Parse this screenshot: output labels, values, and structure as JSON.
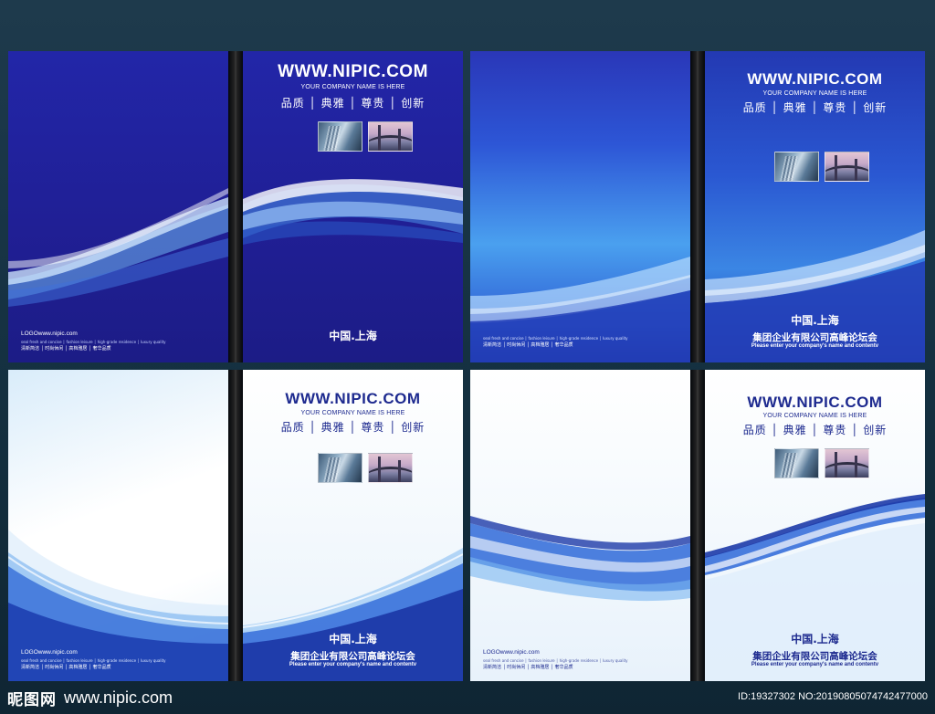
{
  "covers": [
    {
      "variant": "dark-wave",
      "url": "WWW.NIPIC.COM",
      "company_en": "YOUR COMPANY NAME IS HERE",
      "slogan": "品质 │ 典雅 │ 尊贵 │ 创新",
      "city": "中国.上海",
      "logo": "LOGOwww.nipic.com",
      "fine_print": "seal fresh and concise │ fashion leisure │ high-grade residence │ luxury quality",
      "features": "清新简洁 │ 时尚休闲 │ 高档雅居 │ 奢华品质"
    },
    {
      "variant": "sky-wave",
      "url": "WWW.NIPIC.COM",
      "company_en": "YOUR COMPANY NAME IS HERE",
      "slogan": "品质 │ 典雅 │ 尊贵 │ 创新",
      "city": "中国.上海",
      "company_cn": "集团企业有限公司高峰论坛会",
      "enter_text": "Please enter your company's name and contentv",
      "fine_print": "seal fresh and concise │ fashion leisure │ high-grade residence │ luxury quality",
      "features": "清新简洁 │ 时尚休闲 │ 高档雅居 │ 奢华品质"
    },
    {
      "variant": "white-sky",
      "url": "WWW.NIPIC.COM",
      "company_en": "YOUR COMPANY NAME IS HERE",
      "slogan": "品质 │ 典雅 │ 尊贵 │ 创新",
      "city": "中国.上海",
      "company_cn": "集团企业有限公司高峰论坛会",
      "enter_text": "Please enter your company's name and contentv",
      "logo": "LOGOwww.nipic.com",
      "fine_print": "seal fresh and concise │ fashion leisure │ high-grade residence │ luxury quality",
      "features": "清新简洁 │ 时尚休闲 │ 高档雅居 │ 奢华品质"
    },
    {
      "variant": "white-wave",
      "url": "WWW.NIPIC.COM",
      "company_en": "YOUR COMPANY NAME IS HERE",
      "slogan": "品质 │ 典雅 │ 尊贵 │ 创新",
      "city": "中国.上海",
      "company_cn": "集团企业有限公司高峰论坛会",
      "enter_text": "Please enter your company's name and contentv",
      "logo": "LOGOwww.nipic.com",
      "fine_print": "seal fresh and concise │ fashion leisure │ high-grade residence │ luxury quality",
      "features": "清新简洁 │ 时尚休闲 │ 高档雅居 │ 奢华品质"
    }
  ],
  "watermark": {
    "site_cn": "昵图网",
    "site_url": "www.nipic.com",
    "id_text": "ID:19327302 NO:20190805074742477000"
  },
  "colors": {
    "navy_text": "#1d2a8f",
    "dark_blue": "#201f95",
    "sky_blue": "#4aa0ef",
    "background": "#143040"
  }
}
